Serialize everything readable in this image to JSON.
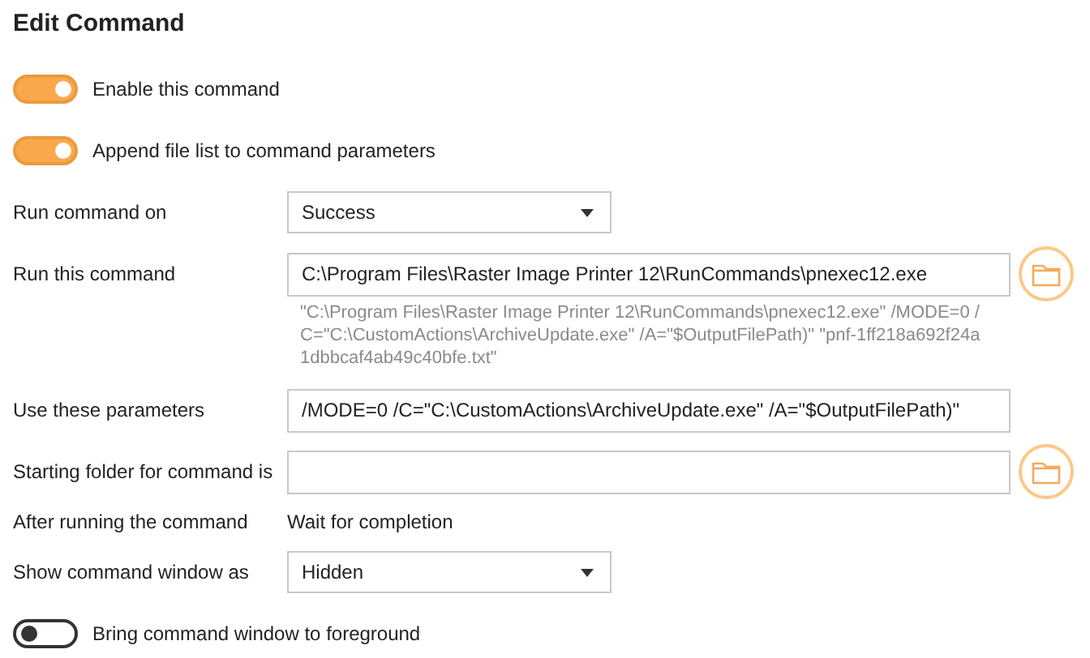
{
  "title": "Edit Command",
  "fields": [
    {
      "kind": "toggle",
      "label": "Enable this command",
      "on": true
    },
    {
      "kind": "toggle",
      "label": "Append file list to command parameters",
      "on": true
    },
    {
      "kind": "select",
      "label": "Run command on",
      "value": "Success"
    },
    {
      "kind": "path",
      "label": "Run this command",
      "value": "C:\\Program Files\\Raster Image Printer 12\\RunCommands\\pnexec12.exe"
    },
    {
      "kind": "hint",
      "text": "\"C:\\Program Files\\Raster Image Printer 12\\RunCommands\\pnexec12.exe\" /MODE=0 /C=\"C:\\CustomActions\\ArchiveUpdate.exe\" /A=\"$OutputFilePath)\" \"pnf-1ff218a692f24a1dbbcaf4ab49c40bfe.txt\""
    },
    {
      "kind": "input",
      "label": "Use these parameters",
      "value": "/MODE=0 /C=\"C:\\CustomActions\\ArchiveUpdate.exe\" /A=\"$OutputFilePath)\""
    },
    {
      "kind": "path",
      "label": "Starting folder for command is"
    },
    {
      "kind": "text",
      "label": "After running the command",
      "value": "Wait for completion"
    },
    {
      "kind": "select",
      "label": "Show command window as",
      "value": "Hidden"
    },
    {
      "kind": "toggle",
      "label": "Bring command window to foreground",
      "on": false
    }
  ]
}
